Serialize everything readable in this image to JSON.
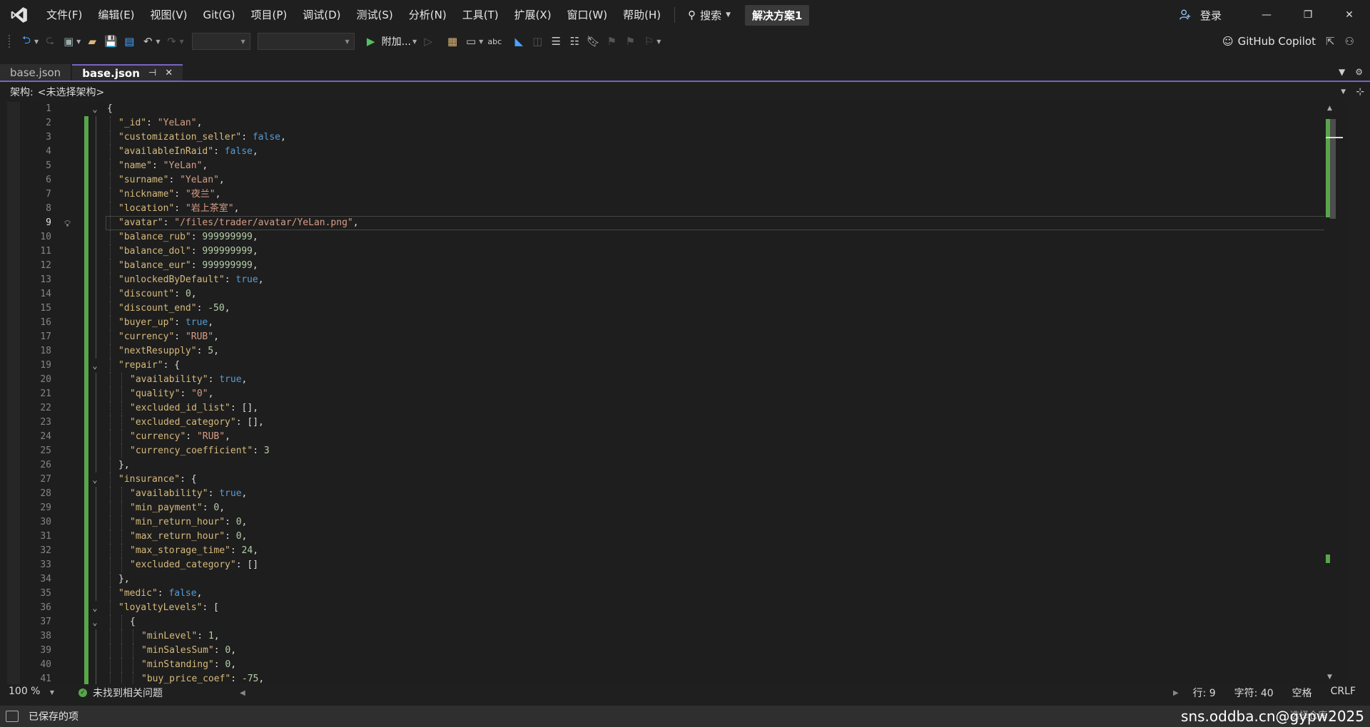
{
  "menu": [
    "文件(F)",
    "编辑(E)",
    "视图(V)",
    "Git(G)",
    "项目(P)",
    "调试(D)",
    "测试(S)",
    "分析(N)",
    "工具(T)",
    "扩展(X)",
    "窗口(W)",
    "帮助(H)"
  ],
  "search_label": "搜索",
  "solution_name": "解决方案1",
  "login_label": "登录",
  "toolbar": {
    "attach_label": "附加...",
    "copilot_label": "GitHub Copilot"
  },
  "tabs": [
    {
      "label": "base.json",
      "active": false
    },
    {
      "label": "base.json",
      "active": true
    }
  ],
  "schema": {
    "label": "架构:",
    "value": "<未选择架构>"
  },
  "editor": {
    "current_line": 9,
    "lines": [
      [
        [
          "p",
          "{"
        ]
      ],
      [
        [
          "k",
          "\"_id\""
        ],
        [
          "p",
          ": "
        ],
        [
          "s",
          "\"YeLan\""
        ],
        [
          "p",
          ","
        ]
      ],
      [
        [
          "k",
          "\"customization_seller\""
        ],
        [
          "p",
          ": "
        ],
        [
          "b",
          "false"
        ],
        [
          "p",
          ","
        ]
      ],
      [
        [
          "k",
          "\"availableInRaid\""
        ],
        [
          "p",
          ": "
        ],
        [
          "b",
          "false"
        ],
        [
          "p",
          ","
        ]
      ],
      [
        [
          "k",
          "\"name\""
        ],
        [
          "p",
          ": "
        ],
        [
          "s",
          "\"YeLan\""
        ],
        [
          "p",
          ","
        ]
      ],
      [
        [
          "k",
          "\"surname\""
        ],
        [
          "p",
          ": "
        ],
        [
          "s",
          "\"YeLan\""
        ],
        [
          "p",
          ","
        ]
      ],
      [
        [
          "k",
          "\"nickname\""
        ],
        [
          "p",
          ": "
        ],
        [
          "s",
          "\"夜兰\""
        ],
        [
          "p",
          ","
        ]
      ],
      [
        [
          "k",
          "\"location\""
        ],
        [
          "p",
          ": "
        ],
        [
          "s",
          "\"岩上茶室\""
        ],
        [
          "p",
          ","
        ]
      ],
      [
        [
          "k",
          "\"avatar\""
        ],
        [
          "p",
          ": "
        ],
        [
          "s",
          "\"/files/trader/avatar/YeLan.png\""
        ],
        [
          "p",
          ","
        ]
      ],
      [
        [
          "k",
          "\"balance_rub\""
        ],
        [
          "p",
          ": "
        ],
        [
          "n",
          "999999999"
        ],
        [
          "p",
          ","
        ]
      ],
      [
        [
          "k",
          "\"balance_dol\""
        ],
        [
          "p",
          ": "
        ],
        [
          "n",
          "999999999"
        ],
        [
          "p",
          ","
        ]
      ],
      [
        [
          "k",
          "\"balance_eur\""
        ],
        [
          "p",
          ": "
        ],
        [
          "n",
          "999999999"
        ],
        [
          "p",
          ","
        ]
      ],
      [
        [
          "k",
          "\"unlockedByDefault\""
        ],
        [
          "p",
          ": "
        ],
        [
          "b",
          "true"
        ],
        [
          "p",
          ","
        ]
      ],
      [
        [
          "k",
          "\"discount\""
        ],
        [
          "p",
          ": "
        ],
        [
          "n",
          "0"
        ],
        [
          "p",
          ","
        ]
      ],
      [
        [
          "k",
          "\"discount_end\""
        ],
        [
          "p",
          ": "
        ],
        [
          "n",
          "-50"
        ],
        [
          "p",
          ","
        ]
      ],
      [
        [
          "k",
          "\"buyer_up\""
        ],
        [
          "p",
          ": "
        ],
        [
          "b",
          "true"
        ],
        [
          "p",
          ","
        ]
      ],
      [
        [
          "k",
          "\"currency\""
        ],
        [
          "p",
          ": "
        ],
        [
          "s",
          "\"RUB\""
        ],
        [
          "p",
          ","
        ]
      ],
      [
        [
          "k",
          "\"nextResupply\""
        ],
        [
          "p",
          ": "
        ],
        [
          "n",
          "5"
        ],
        [
          "p",
          ","
        ]
      ],
      [
        [
          "k",
          "\"repair\""
        ],
        [
          "p",
          ": {"
        ]
      ],
      [
        [
          "k",
          "\"availability\""
        ],
        [
          "p",
          ": "
        ],
        [
          "b",
          "true"
        ],
        [
          "p",
          ","
        ]
      ],
      [
        [
          "k",
          "\"quality\""
        ],
        [
          "p",
          ": "
        ],
        [
          "s",
          "\"0\""
        ],
        [
          "p",
          ","
        ]
      ],
      [
        [
          "k",
          "\"excluded_id_list\""
        ],
        [
          "p",
          ": [],"
        ]
      ],
      [
        [
          "k",
          "\"excluded_category\""
        ],
        [
          "p",
          ": [],"
        ]
      ],
      [
        [
          "k",
          "\"currency\""
        ],
        [
          "p",
          ": "
        ],
        [
          "s",
          "\"RUB\""
        ],
        [
          "p",
          ","
        ]
      ],
      [
        [
          "k",
          "\"currency_coefficient\""
        ],
        [
          "p",
          ": "
        ],
        [
          "n",
          "3"
        ]
      ],
      [
        [
          "p",
          "},"
        ]
      ],
      [
        [
          "k",
          "\"insurance\""
        ],
        [
          "p",
          ": {"
        ]
      ],
      [
        [
          "k",
          "\"availability\""
        ],
        [
          "p",
          ": "
        ],
        [
          "b",
          "true"
        ],
        [
          "p",
          ","
        ]
      ],
      [
        [
          "k",
          "\"min_payment\""
        ],
        [
          "p",
          ": "
        ],
        [
          "n",
          "0"
        ],
        [
          "p",
          ","
        ]
      ],
      [
        [
          "k",
          "\"min_return_hour\""
        ],
        [
          "p",
          ": "
        ],
        [
          "n",
          "0"
        ],
        [
          "p",
          ","
        ]
      ],
      [
        [
          "k",
          "\"max_return_hour\""
        ],
        [
          "p",
          ": "
        ],
        [
          "n",
          "0"
        ],
        [
          "p",
          ","
        ]
      ],
      [
        [
          "k",
          "\"max_storage_time\""
        ],
        [
          "p",
          ": "
        ],
        [
          "n",
          "24"
        ],
        [
          "p",
          ","
        ]
      ],
      [
        [
          "k",
          "\"excluded_category\""
        ],
        [
          "p",
          ": []"
        ]
      ],
      [
        [
          "p",
          "},"
        ]
      ],
      [
        [
          "k",
          "\"medic\""
        ],
        [
          "p",
          ": "
        ],
        [
          "b",
          "false"
        ],
        [
          "p",
          ","
        ]
      ],
      [
        [
          "k",
          "\"loyaltyLevels\""
        ],
        [
          "p",
          ": ["
        ]
      ],
      [
        [
          "p",
          "{"
        ]
      ],
      [
        [
          "k",
          "\"minLevel\""
        ],
        [
          "p",
          ": "
        ],
        [
          "n",
          "1"
        ],
        [
          "p",
          ","
        ]
      ],
      [
        [
          "k",
          "\"minSalesSum\""
        ],
        [
          "p",
          ": "
        ],
        [
          "n",
          "0"
        ],
        [
          "p",
          ","
        ]
      ],
      [
        [
          "k",
          "\"minStanding\""
        ],
        [
          "p",
          ": "
        ],
        [
          "n",
          "0"
        ],
        [
          "p",
          ","
        ]
      ],
      [
        [
          "k",
          "\"buy_price_coef\""
        ],
        [
          "p",
          ": "
        ],
        [
          "n",
          "-75"
        ],
        [
          "p",
          ","
        ]
      ]
    ]
  },
  "status": {
    "zoom": "100 %",
    "issues": "未找到相关问题",
    "line": "行: 9",
    "char": "字符: 40",
    "indent": "空格",
    "eol": "CRLF",
    "saved": "已保存的项",
    "branch": "选择仓库",
    "watermark": "sns.oddba.cn@gypw2025"
  }
}
